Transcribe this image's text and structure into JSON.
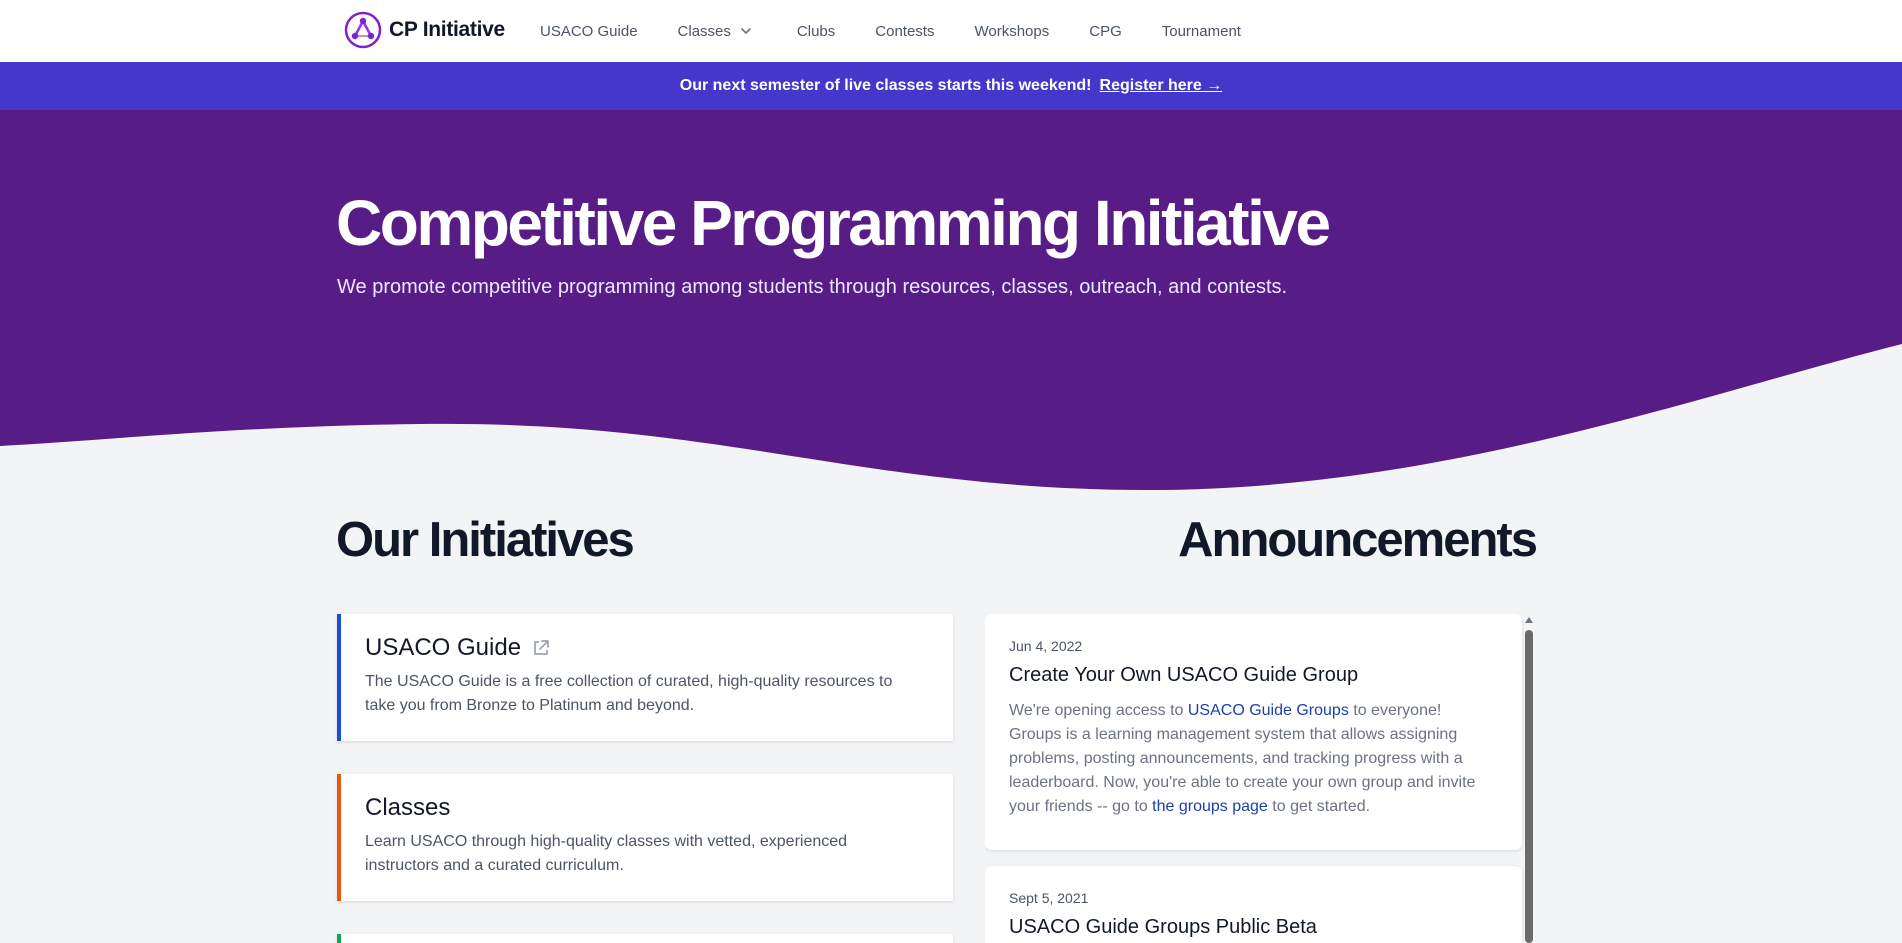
{
  "nav": {
    "logo_text": "CP Initiative",
    "items": [
      {
        "label": "USACO Guide"
      },
      {
        "label": "Classes",
        "has_dropdown": true
      },
      {
        "label": "Clubs"
      },
      {
        "label": "Contests"
      },
      {
        "label": "Workshops"
      },
      {
        "label": "CPG"
      },
      {
        "label": "Tournament"
      }
    ]
  },
  "banner": {
    "text": "Our next semester of live classes starts this weekend!",
    "link_label": "Register here →"
  },
  "hero": {
    "title": "Competitive Programming Initiative",
    "subtitle": "We promote competitive programming among students through resources, classes, outreach, and contests."
  },
  "initiatives": {
    "heading": "Our Initiatives",
    "cards": [
      {
        "title": "USACO Guide",
        "desc": "The USACO Guide is a free collection of curated, high-quality resources to take you from Bronze to Platinum and beyond.",
        "external": true,
        "color": "#1d4ed8"
      },
      {
        "title": "Classes",
        "desc": "Learn USACO through high-quality classes with vetted, experienced instructors and a curated curriculum.",
        "external": false,
        "color": "#ea580c"
      },
      {
        "title": "",
        "desc": "",
        "external": false,
        "color": "#16a34a"
      }
    ]
  },
  "announcements": {
    "heading": "Announcements",
    "items": [
      {
        "date": "Jun 4, 2022",
        "title": "Create Your Own USACO Guide Group",
        "body_pre": "We're opening access to ",
        "link1": "USACO Guide Groups",
        "body_mid": " to everyone! Groups is a learning management system that allows assigning problems, posting announcements, and tracking progress with a leaderboard. Now, you're able to create your own group and invite your friends -- go to ",
        "link2": "the groups page",
        "body_post": " to get started."
      },
      {
        "date": "Sept 5, 2021",
        "title": "USACO Guide Groups Public Beta"
      }
    ]
  },
  "colors": {
    "hero_purple": "#581c87",
    "banner_indigo": "#4338ca",
    "page_bg": "#f3f4f6",
    "link_blue": "#1e40af"
  }
}
